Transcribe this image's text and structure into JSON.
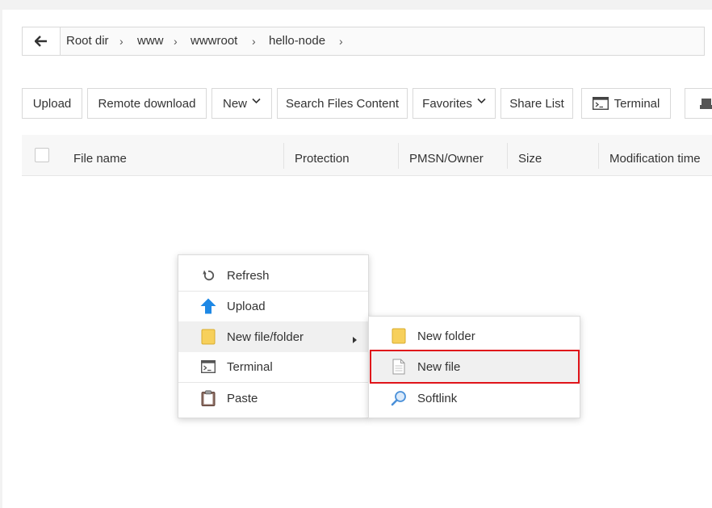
{
  "breadcrumb": {
    "items": [
      "Root dir",
      "www",
      "wwwroot",
      "hello-node"
    ]
  },
  "toolbar": {
    "upload": "Upload",
    "remote_download": "Remote download",
    "new": "New",
    "search_files_content": "Search Files Content",
    "favorites": "Favorites",
    "share_list": "Share List",
    "terminal": "Terminal"
  },
  "table": {
    "columns": [
      "File name",
      "Protection",
      "PMSN/Owner",
      "Size",
      "Modification time"
    ]
  },
  "context_menu": {
    "items": [
      "Refresh",
      "Upload",
      "New file/folder",
      "Terminal",
      "Paste"
    ]
  },
  "submenu": {
    "items": [
      "New folder",
      "New file",
      "Softlink"
    ]
  },
  "colors": {
    "highlight_border": "#e0141a",
    "folder_yellow": "#f7d05b",
    "upload_blue": "#1e88e5"
  }
}
